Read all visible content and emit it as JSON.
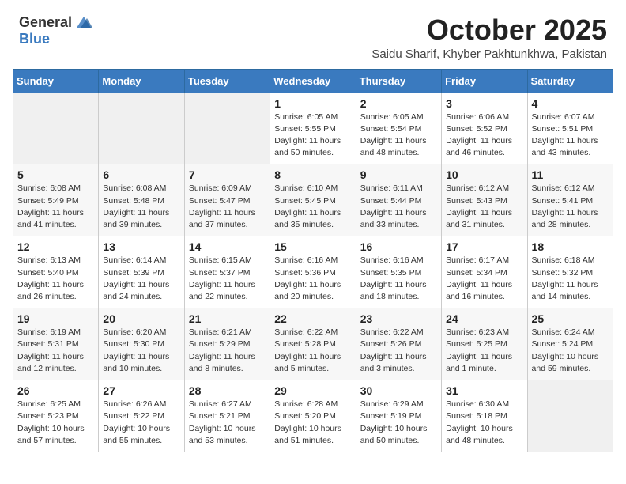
{
  "header": {
    "logo_general": "General",
    "logo_blue": "Blue",
    "month": "October 2025",
    "location": "Saidu Sharif, Khyber Pakhtunkhwa, Pakistan"
  },
  "days_of_week": [
    "Sunday",
    "Monday",
    "Tuesday",
    "Wednesday",
    "Thursday",
    "Friday",
    "Saturday"
  ],
  "weeks": [
    [
      {
        "day": "",
        "info": ""
      },
      {
        "day": "",
        "info": ""
      },
      {
        "day": "",
        "info": ""
      },
      {
        "day": "1",
        "info": "Sunrise: 6:05 AM\nSunset: 5:55 PM\nDaylight: 11 hours\nand 50 minutes."
      },
      {
        "day": "2",
        "info": "Sunrise: 6:05 AM\nSunset: 5:54 PM\nDaylight: 11 hours\nand 48 minutes."
      },
      {
        "day": "3",
        "info": "Sunrise: 6:06 AM\nSunset: 5:52 PM\nDaylight: 11 hours\nand 46 minutes."
      },
      {
        "day": "4",
        "info": "Sunrise: 6:07 AM\nSunset: 5:51 PM\nDaylight: 11 hours\nand 43 minutes."
      }
    ],
    [
      {
        "day": "5",
        "info": "Sunrise: 6:08 AM\nSunset: 5:49 PM\nDaylight: 11 hours\nand 41 minutes."
      },
      {
        "day": "6",
        "info": "Sunrise: 6:08 AM\nSunset: 5:48 PM\nDaylight: 11 hours\nand 39 minutes."
      },
      {
        "day": "7",
        "info": "Sunrise: 6:09 AM\nSunset: 5:47 PM\nDaylight: 11 hours\nand 37 minutes."
      },
      {
        "day": "8",
        "info": "Sunrise: 6:10 AM\nSunset: 5:45 PM\nDaylight: 11 hours\nand 35 minutes."
      },
      {
        "day": "9",
        "info": "Sunrise: 6:11 AM\nSunset: 5:44 PM\nDaylight: 11 hours\nand 33 minutes."
      },
      {
        "day": "10",
        "info": "Sunrise: 6:12 AM\nSunset: 5:43 PM\nDaylight: 11 hours\nand 31 minutes."
      },
      {
        "day": "11",
        "info": "Sunrise: 6:12 AM\nSunset: 5:41 PM\nDaylight: 11 hours\nand 28 minutes."
      }
    ],
    [
      {
        "day": "12",
        "info": "Sunrise: 6:13 AM\nSunset: 5:40 PM\nDaylight: 11 hours\nand 26 minutes."
      },
      {
        "day": "13",
        "info": "Sunrise: 6:14 AM\nSunset: 5:39 PM\nDaylight: 11 hours\nand 24 minutes."
      },
      {
        "day": "14",
        "info": "Sunrise: 6:15 AM\nSunset: 5:37 PM\nDaylight: 11 hours\nand 22 minutes."
      },
      {
        "day": "15",
        "info": "Sunrise: 6:16 AM\nSunset: 5:36 PM\nDaylight: 11 hours\nand 20 minutes."
      },
      {
        "day": "16",
        "info": "Sunrise: 6:16 AM\nSunset: 5:35 PM\nDaylight: 11 hours\nand 18 minutes."
      },
      {
        "day": "17",
        "info": "Sunrise: 6:17 AM\nSunset: 5:34 PM\nDaylight: 11 hours\nand 16 minutes."
      },
      {
        "day": "18",
        "info": "Sunrise: 6:18 AM\nSunset: 5:32 PM\nDaylight: 11 hours\nand 14 minutes."
      }
    ],
    [
      {
        "day": "19",
        "info": "Sunrise: 6:19 AM\nSunset: 5:31 PM\nDaylight: 11 hours\nand 12 minutes."
      },
      {
        "day": "20",
        "info": "Sunrise: 6:20 AM\nSunset: 5:30 PM\nDaylight: 11 hours\nand 10 minutes."
      },
      {
        "day": "21",
        "info": "Sunrise: 6:21 AM\nSunset: 5:29 PM\nDaylight: 11 hours\nand 8 minutes."
      },
      {
        "day": "22",
        "info": "Sunrise: 6:22 AM\nSunset: 5:28 PM\nDaylight: 11 hours\nand 5 minutes."
      },
      {
        "day": "23",
        "info": "Sunrise: 6:22 AM\nSunset: 5:26 PM\nDaylight: 11 hours\nand 3 minutes."
      },
      {
        "day": "24",
        "info": "Sunrise: 6:23 AM\nSunset: 5:25 PM\nDaylight: 11 hours\nand 1 minute."
      },
      {
        "day": "25",
        "info": "Sunrise: 6:24 AM\nSunset: 5:24 PM\nDaylight: 10 hours\nand 59 minutes."
      }
    ],
    [
      {
        "day": "26",
        "info": "Sunrise: 6:25 AM\nSunset: 5:23 PM\nDaylight: 10 hours\nand 57 minutes."
      },
      {
        "day": "27",
        "info": "Sunrise: 6:26 AM\nSunset: 5:22 PM\nDaylight: 10 hours\nand 55 minutes."
      },
      {
        "day": "28",
        "info": "Sunrise: 6:27 AM\nSunset: 5:21 PM\nDaylight: 10 hours\nand 53 minutes."
      },
      {
        "day": "29",
        "info": "Sunrise: 6:28 AM\nSunset: 5:20 PM\nDaylight: 10 hours\nand 51 minutes."
      },
      {
        "day": "30",
        "info": "Sunrise: 6:29 AM\nSunset: 5:19 PM\nDaylight: 10 hours\nand 50 minutes."
      },
      {
        "day": "31",
        "info": "Sunrise: 6:30 AM\nSunset: 5:18 PM\nDaylight: 10 hours\nand 48 minutes."
      },
      {
        "day": "",
        "info": ""
      }
    ]
  ]
}
